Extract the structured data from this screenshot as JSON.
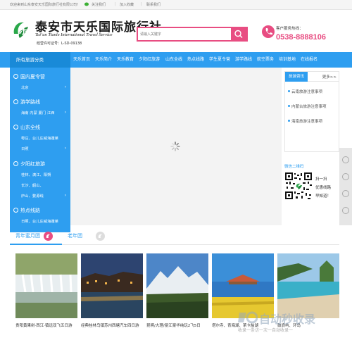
{
  "topbar": {
    "welcome": "欢迎来到山东泰安天乐国际旅行社有限公司！",
    "follow": "关注我们",
    "favorite": "加入收藏",
    "contact": "联系我们"
  },
  "header": {
    "brand_cn": "泰安市天乐国际旅行社",
    "brand_en": "Tai’an Tianle International Travel Service",
    "license": "经营许可证号：L-SD-09138",
    "search_placeholder": "请输入关键字",
    "hotline_label": "客户服务热线：",
    "hotline_number": "0538-8888106"
  },
  "nav": {
    "all": "所有旅游分类",
    "items": [
      "天乐首页",
      "天乐简介",
      "天乐教育",
      "夕阳红旅游",
      "山东全线",
      "热点线路",
      "学生夏令营",
      "游学路线",
      "航空票务",
      "培训基地",
      "在线报名"
    ]
  },
  "sidebar": {
    "categories": [
      {
        "title": "国内夏令营",
        "subs": [
          "北京"
        ]
      },
      {
        "title": "游学路线",
        "subs": [
          "海南  内蒙  厦门  江西"
        ]
      },
      {
        "title": "山东全线",
        "subs": [
          "枣庄、台儿庄威海蓬莱",
          "日照"
        ]
      },
      {
        "title": "夕阳红旅游",
        "subs": [
          "桂林、漓江、阳朔",
          "长沙、韶山、",
          "庐山、婺源线"
        ]
      },
      {
        "title": "热点线路",
        "subs": [
          "日照、台儿庄威海蓬莱"
        ]
      }
    ]
  },
  "news": {
    "tab": "旅游资讯",
    "more": "更多>>",
    "items": [
      "云南旅游注意事项",
      "内蒙古旅游注意事项",
      "海南旅游注意事项"
    ]
  },
  "qr": {
    "title": "微信二维码",
    "lines": [
      "扫一扫",
      "优惠线路",
      "早知道！"
    ]
  },
  "tabs": {
    "first": "青年蜜月团",
    "second": "老年团"
  },
  "cards": [
    {
      "caption": "贵阳黄果树·西江·镇远双飞五日游"
    },
    {
      "caption": "经典桂林乌镇苏州西塘汽车四日游"
    },
    {
      "caption": "昆明/大理/丽江豪华纯玩2飞5日"
    },
    {
      "caption": "塔尔寺、青海湖、茶卡盐湖"
    },
    {
      "caption": "鼓浪屿、环岛"
    }
  ],
  "watermark": {
    "title": "自动秒收录",
    "sub": "收录一条访一次一自动收录一"
  },
  "colors": {
    "brand_blue": "#2e9ef0",
    "accent_pink": "#e84d82"
  }
}
